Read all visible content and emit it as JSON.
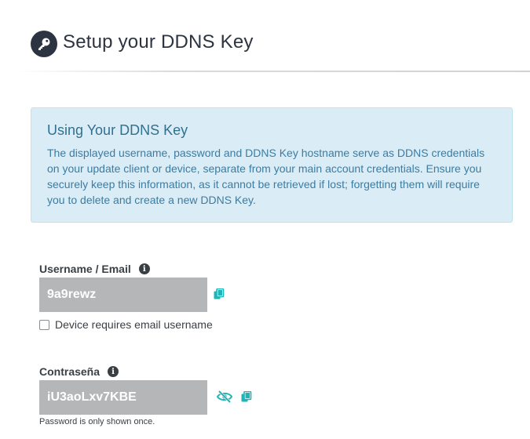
{
  "header": {
    "title": "Setup your DDNS Key",
    "icon": "key-icon"
  },
  "alert": {
    "title": "Using Your DDNS Key",
    "body": "The displayed username, password and DDNS Key hostname serve as DDNS credentials on your update client or device, separate from your main account credentials. Ensure you securely keep this information, as it cannot be retrieved if lost; forgetting them will require you to delete and create a new DDNS Key."
  },
  "username_field": {
    "label": "Username / Email",
    "value": "9a9rewz",
    "info_icon": "info-icon",
    "copy_icon": "copy-icon"
  },
  "email_checkbox": {
    "label": "Device requires email username",
    "checked": false
  },
  "password_field": {
    "label": "Contraseña",
    "value": "iU3aoLxv7KBE",
    "info_icon": "info-icon",
    "visibility_icon": "eye-slash-icon",
    "copy_icon": "copy-icon",
    "help": "Password is only shown once."
  },
  "colors": {
    "accent": "#1fb5b8",
    "header_dark": "#2b3440",
    "alert_bg": "#daedf6",
    "alert_text": "#31708f",
    "field_bg": "#b5b6b7"
  }
}
